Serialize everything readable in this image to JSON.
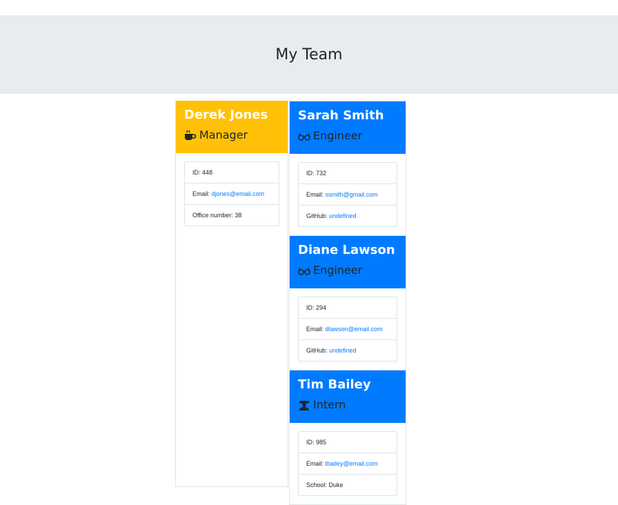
{
  "header": {
    "title": "My Team"
  },
  "employees": [
    {
      "name": "Derek Jones",
      "role": "Manager",
      "icon": "mug-icon",
      "id_label": "ID: 448",
      "email_prefix": "Email: ",
      "email": "djones@email.com",
      "extra_prefix": "Office number: 38",
      "extra_value": ""
    },
    {
      "name": "Sarah Smith",
      "role": "Engineer",
      "icon": "glasses-icon",
      "id_label": "ID: 732",
      "email_prefix": "Email: ",
      "email": "ssmith@gmail.com",
      "extra_prefix": "GitHub: ",
      "extra_value": "undefined"
    },
    {
      "name": "Diane Lawson",
      "role": "Engineer",
      "icon": "glasses-icon",
      "id_label": "ID: 294",
      "email_prefix": "Email: ",
      "email": "dlawson@email.com",
      "extra_prefix": "GitHub: ",
      "extra_value": "undefined"
    },
    {
      "name": "Tim Bailey",
      "role": "Intern",
      "icon": "graduate-icon",
      "id_label": "ID: 985",
      "email_prefix": "Email: ",
      "email": "tbailey@email.com",
      "extra_prefix": "School: Duke",
      "extra_value": ""
    }
  ],
  "colors": {
    "manager": "#ffc107",
    "engineer": "#007bff",
    "intern": "#007bff",
    "jumbotron": "#e9ecef"
  }
}
